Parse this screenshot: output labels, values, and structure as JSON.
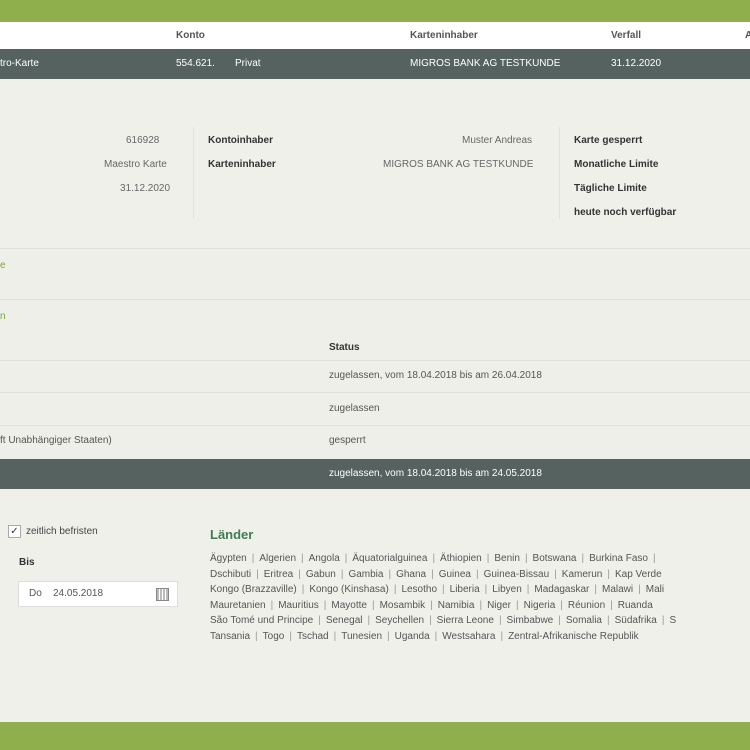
{
  "header": {
    "konto": "Konto",
    "karteninhaber": "Karteninhaber",
    "verfall": "Verfall",
    "extra": "A"
  },
  "selected_card": {
    "type": "tro-Karte",
    "konto": "554.621.",
    "konto_type": "Privat",
    "karteninhaber": "MIGROS BANK AG TESTKUNDE",
    "verfall": "31.12.2020"
  },
  "details": {
    "col1": [
      "616928",
      "Maestro Karte",
      "31.12.2020"
    ],
    "kontoinhaber_label": "Kontoinhaber",
    "kontoinhaber_value": "Muster Andreas",
    "karteninhaber_label": "Karteninhaber",
    "karteninhaber_value": "MIGROS BANK AG TESTKUNDE",
    "right_labels": [
      "Karte gesperrt",
      "Monatliche Limite",
      "Tägliche Limite",
      "heute noch verfügbar"
    ]
  },
  "sections": {
    "s1": "e",
    "s2": "n"
  },
  "table": {
    "status_header": "Status",
    "rows": [
      {
        "left": "",
        "status": "zugelassen, vom 18.04.2018 bis am 26.04.2018"
      },
      {
        "left": "",
        "status": "zugelassen"
      },
      {
        "left": "ft Unabhängiger Staaten)",
        "status": "gesperrt"
      }
    ],
    "selected_status": "zugelassen, vom 18.04.2018 bis am 24.05.2018"
  },
  "form": {
    "checkbox_label": "zeitlich befristen",
    "checkbox_mark": "✓",
    "bis_label": "Bis",
    "bis_day": "Do",
    "bis_value": "24.05.2018"
  },
  "countries": {
    "title": "Länder",
    "list": [
      "Ägypten",
      "Algerien",
      "Angola",
      "Äquatorialguinea",
      "Äthiopien",
      "Benin",
      "Botswana",
      "Burkina Faso",
      "",
      "Dschibuti",
      "Eritrea",
      "Gabun",
      "Gambia",
      "Ghana",
      "Guinea",
      "Guinea-Bissau",
      "Kamerun",
      "Kap Verde",
      "Kongo (Brazzaville)",
      "Kongo (Kinshasa)",
      "Lesotho",
      "Liberia",
      "Libyen",
      "Madagaskar",
      "Malawi",
      "Mali",
      "Mauretanien",
      "Mauritius",
      "Mayotte",
      "Mosambik",
      "Namibia",
      "Niger",
      "Nigeria",
      "Réunion",
      "Ruanda",
      "São Tomé und Principe",
      "Senegal",
      "Seychellen",
      "Sierra Leone",
      "Simbabwe",
      "Somalia",
      "Südafrika",
      "S",
      "Tansania",
      "Togo",
      "Tschad",
      "Tunesien",
      "Uganda",
      "Westsahara",
      "Zentral-Afrikanische Republik"
    ]
  },
  "colors": {
    "outer": "#8faf4d",
    "dark_bar": "#56625f",
    "green_text": "#3f7b55"
  }
}
